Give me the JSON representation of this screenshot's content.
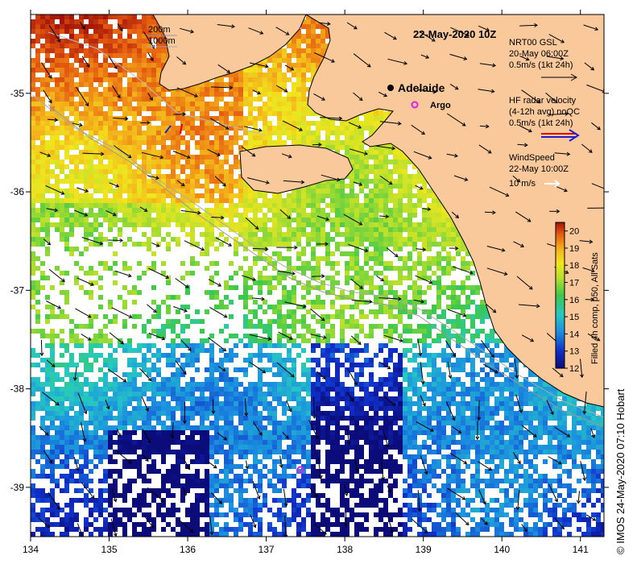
{
  "map": {
    "title": "22-May-2020 10Z",
    "x_ticks": [
      "134",
      "135",
      "136",
      "137",
      "138",
      "139",
      "140",
      "141"
    ],
    "y_ticks": [
      "-35",
      "-36",
      "-37",
      "-38",
      "-39"
    ],
    "x_range": [
      134,
      141.3
    ],
    "y_range": [
      -39.5,
      -34.2
    ],
    "land_color": "#f9c89b",
    "no_data_color": "#ffffff",
    "places": [
      {
        "name": "Adelaide",
        "lon": 138.6,
        "lat": -34.93
      },
      {
        "name": "Argo",
        "lon": 138.9,
        "lat": -35.1
      }
    ],
    "argo_float": {
      "lon": 137.43,
      "lat": -38.83
    }
  },
  "depth_legend": {
    "line1": "200m",
    "line2": "1000m"
  },
  "legend": {
    "gsl_title": "NRT00 GSL",
    "gsl_time": "20-May 06:00Z",
    "gsl_scale": "0.5m/s (1kt 24h)",
    "hf_title": "HF radar velocity",
    "hf_avg": "(4-12h avg) noQC",
    "hf_scale": "0.5m/s (1kt 24h)",
    "wind_title": "WindSpeed",
    "wind_time": "22-May 10:00Z",
    "wind_scale": "10 m/s"
  },
  "colorbar": {
    "label": "Filled 4h comp, p50, All Sats",
    "ticks": [
      "20",
      "19",
      "18",
      "17",
      "16",
      "15",
      "14",
      "13",
      "12"
    ],
    "min": 12,
    "max": 20.5
  },
  "credit": "© IMOS 24-May-2020 07:10 Hobart"
}
